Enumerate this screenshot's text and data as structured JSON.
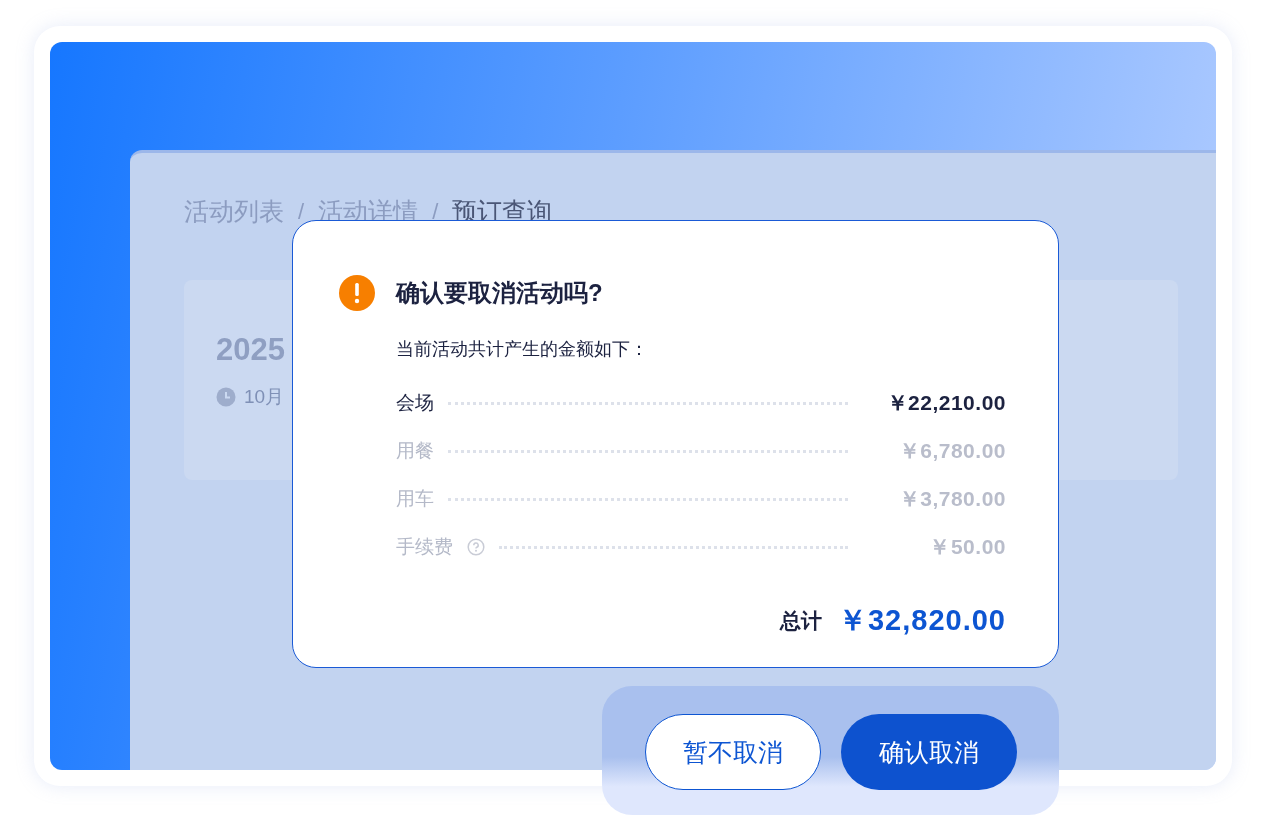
{
  "breadcrumb": [
    {
      "label": "活动列表",
      "selected": false
    },
    {
      "label": "活动详情",
      "selected": false
    },
    {
      "label": "预订查询",
      "selected": true
    }
  ],
  "breadcrumb_separator": "/",
  "event_card": {
    "title": "2025",
    "time": "10月"
  },
  "dialog": {
    "title": "确认要取消活动吗?",
    "subtitle": "当前活动共计产生的金额如下：",
    "items": [
      {
        "label": "会场",
        "amount": "￥22,210.00",
        "disabled": false,
        "help": false
      },
      {
        "label": "用餐",
        "amount": "￥6,780.00",
        "disabled": true,
        "help": false
      },
      {
        "label": "用车",
        "amount": "￥3,780.00",
        "disabled": true,
        "help": false
      },
      {
        "label": "手续费",
        "amount": "￥50.00",
        "disabled": true,
        "help": true
      }
    ],
    "total_label": "总计",
    "total_amount": "￥32,820.00"
  },
  "buttons": [
    {
      "label": "暂不取消",
      "kind": "secondary"
    },
    {
      "label": "确认取消",
      "kind": "primary"
    }
  ]
}
